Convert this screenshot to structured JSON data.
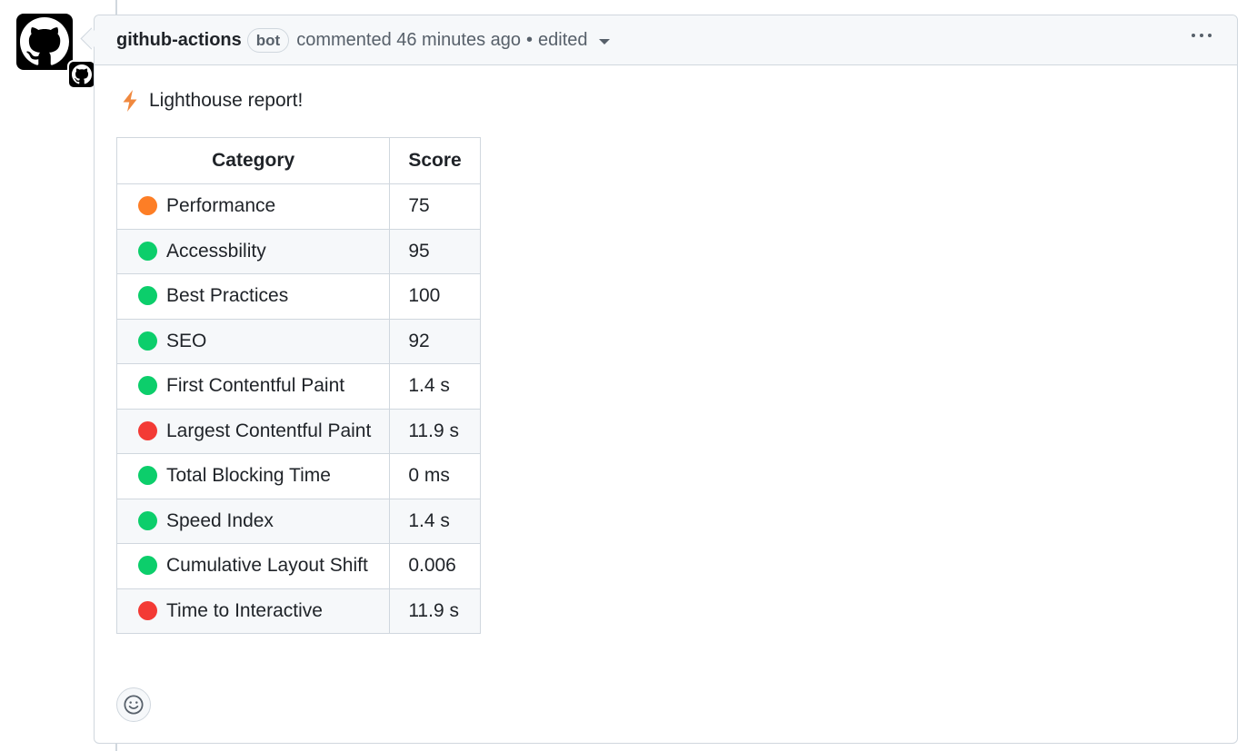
{
  "comment": {
    "author": "github-actions",
    "badge": "bot",
    "meta": "commented 46 minutes ago",
    "separator": "•",
    "edited": "edited",
    "avatar_icon": "github-logo-icon",
    "menu_icon": "kebab-horizontal-icon"
  },
  "report": {
    "icon": "zap-icon",
    "icon_color": "#f0883e",
    "title": "Lighthouse report!"
  },
  "table": {
    "headers": [
      "Category",
      "Score"
    ],
    "rows": [
      {
        "status": "orange",
        "color": "#fd7e26",
        "category": "Performance",
        "score": "75"
      },
      {
        "status": "green",
        "color": "#0cce6b",
        "category": "Accessbility",
        "score": "95"
      },
      {
        "status": "green",
        "color": "#0cce6b",
        "category": "Best Practices",
        "score": "100"
      },
      {
        "status": "green",
        "color": "#0cce6b",
        "category": "SEO",
        "score": "92"
      },
      {
        "status": "green",
        "color": "#0cce6b",
        "category": "First Contentful Paint",
        "score": "1.4 s"
      },
      {
        "status": "red",
        "color": "#f33a35",
        "category": "Largest Contentful Paint",
        "score": "11.9 s"
      },
      {
        "status": "green",
        "color": "#0cce6b",
        "category": "Total Blocking Time",
        "score": "0 ms"
      },
      {
        "status": "green",
        "color": "#0cce6b",
        "category": "Speed Index",
        "score": "1.4 s"
      },
      {
        "status": "green",
        "color": "#0cce6b",
        "category": "Cumulative Layout Shift",
        "score": "0.006"
      },
      {
        "status": "red",
        "color": "#f33a35",
        "category": "Time to Interactive",
        "score": "11.9 s"
      }
    ]
  },
  "reactions": {
    "icon": "smiley-icon"
  }
}
